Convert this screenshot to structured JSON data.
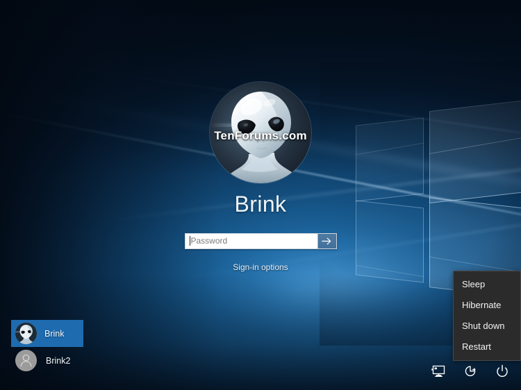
{
  "screen": {
    "kind": "windows-10-lock-sign-in-screen",
    "wallpaper_name": "windows-10-hero-wallpaper"
  },
  "signin": {
    "avatar_icon": "alien-head-avatar",
    "username": "Brink",
    "password": {
      "value": "",
      "placeholder": "Password",
      "submit_icon": "arrow-right-icon"
    },
    "signin_options_label": "Sign-in options"
  },
  "watermark": {
    "text": "TenForums.com"
  },
  "user_list": [
    {
      "name": "Brink",
      "avatar_icon": "alien-head-avatar",
      "selected": true
    },
    {
      "name": "Brink2",
      "avatar_icon": "default-person-icon",
      "selected": false
    }
  ],
  "power_menu": {
    "visible": true,
    "items": [
      {
        "label": "Sleep"
      },
      {
        "label": "Hibernate"
      },
      {
        "label": "Shut down"
      },
      {
        "label": "Restart"
      }
    ]
  },
  "tray": {
    "items": [
      {
        "icon": "network-monitor-icon",
        "title": "Network"
      },
      {
        "icon": "ease-of-access-icon",
        "title": "Ease of Access"
      },
      {
        "icon": "power-icon",
        "title": "Power"
      }
    ]
  },
  "colors": {
    "accent_selected": "#1e6bb0",
    "menu_background": "#2b2b2b",
    "menu_border": "#4a4a4a",
    "menu_text": "#f3f3f3",
    "wallpaper_blue": "#11538c",
    "submit_button": "#44719c",
    "watermark_text": "#ffffff"
  }
}
